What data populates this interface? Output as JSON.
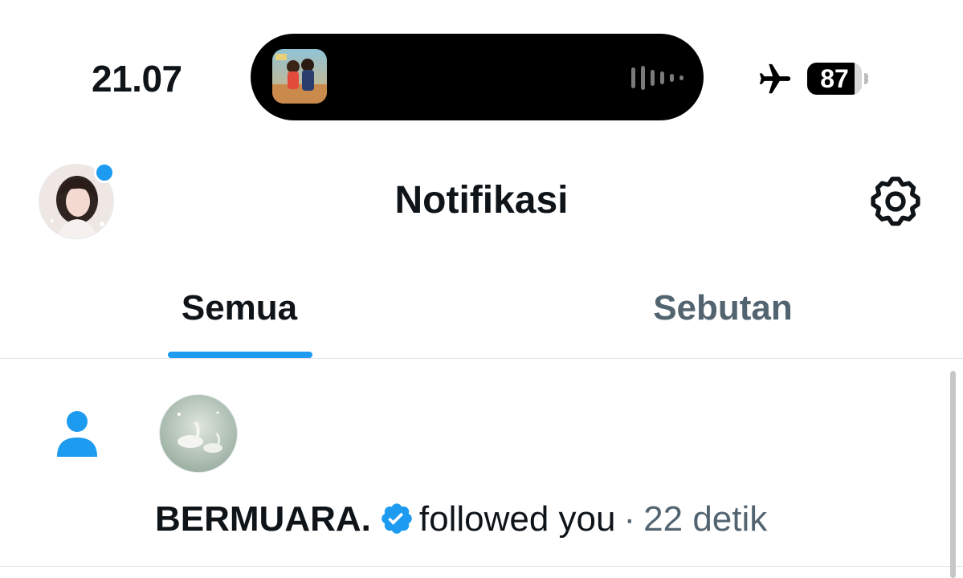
{
  "status_bar": {
    "time": "21.07",
    "battery_level": "87",
    "battery_fraction": 0.87,
    "airplane_mode": true
  },
  "dynamic_island": {
    "media_playing": true
  },
  "header": {
    "title": "Notifikasi",
    "avatar_has_badge": true
  },
  "tabs": [
    {
      "label": "Semua",
      "active": true
    },
    {
      "label": "Sebutan",
      "active": false
    }
  ],
  "notifications": [
    {
      "type": "follow",
      "user_name": "BERMUARA.",
      "verified": true,
      "action": "followed you",
      "separator": "·",
      "time": "22 detik"
    }
  ],
  "colors": {
    "accent": "#1d9bf0",
    "text_primary": "#0f1419",
    "text_secondary": "#536471",
    "divider": "#e1e4e8"
  },
  "icons": {
    "airplane": "airplane-icon",
    "settings": "gear-icon",
    "follow": "person-icon",
    "verified": "verified-badge-icon",
    "audio": "audio-waveform-icon"
  }
}
